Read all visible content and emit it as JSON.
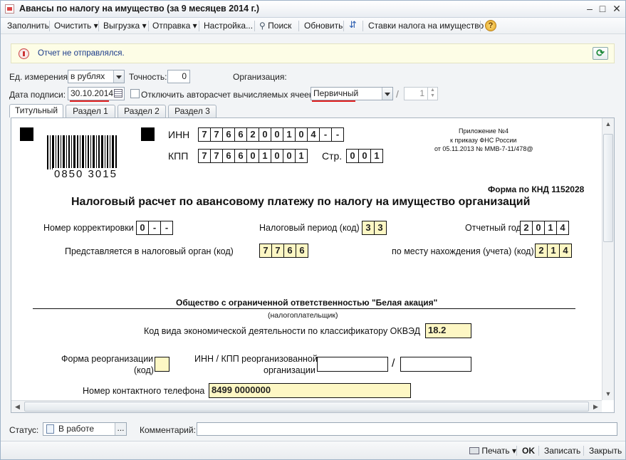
{
  "window": {
    "title": "Авансы по налогу на имущество (за 9 месяцев 2014 г.)"
  },
  "toolbar": {
    "fill": "Заполнить",
    "clear": "Очистить",
    "export": "Выгрузка",
    "send": "Отправка",
    "settings": "Настройка...",
    "search": "Поиск",
    "update": "Обновить",
    "rates": "Ставки налога на имущество",
    "help": "?"
  },
  "notice": {
    "text": "Отчет не отправлялся."
  },
  "params": {
    "unit_label": "Ед. измерения:",
    "unit_value": "в рублях",
    "precision_label": "Точность:",
    "precision_value": "0",
    "org_label": "Организация:",
    "sign_date_label": "Дата подписи:",
    "sign_date_value": "30.10.2014",
    "autocalc_label": "Отключить авторасчет вычисляемых ячеек",
    "report_kind": "Первичный",
    "correction_number": "1"
  },
  "tabs": [
    "Титульный",
    "Раздел 1",
    "Раздел 2",
    "Раздел 3"
  ],
  "form": {
    "inn_label": "ИНН",
    "inn": [
      "7",
      "7",
      "6",
      "6",
      "2",
      "0",
      "0",
      "1",
      "0",
      "4",
      "-",
      "-"
    ],
    "kpp_label": "КПП",
    "kpp": [
      "7",
      "7",
      "6",
      "6",
      "0",
      "1",
      "0",
      "0",
      "1"
    ],
    "page_label": "Стр.",
    "page": [
      "0",
      "0",
      "1"
    ],
    "barcode_digits": "0850 3015",
    "appendix_line1": "Приложение №4",
    "appendix_line2": "к приказу ФНС России",
    "appendix_line3": "от 05.11.2013 № ММВ-7-11/478@",
    "knd": "Форма по КНД 1152028",
    "title": "Налоговый расчет по авансовому платежу по налогу на имущество организаций",
    "correction_label": "Номер корректировки",
    "correction": [
      "0",
      "-",
      "-"
    ],
    "period_label": "Налоговый период  (код)",
    "period": [
      "3",
      "3"
    ],
    "year_label": "Отчетный год",
    "year": [
      "2",
      "0",
      "1",
      "4"
    ],
    "authority_label": "Представляется в налоговый орган  (код)",
    "authority": [
      "7",
      "7",
      "6",
      "6"
    ],
    "location_label": "по месту нахождения (учета)  (код)",
    "location": [
      "2",
      "1",
      "4"
    ],
    "company": "Общество с ограниченной ответственностью \"Белая акация\"",
    "taxpayer_caption": "(налогоплательщик)",
    "okved_label": "Код вида экономической деятельности по классификатору ОКВЭД",
    "okved": "18.2",
    "reorg_label_1": "Форма реорганизации",
    "reorg_label_2": "(код)",
    "reorg_inn_label_1": "ИНН / КПП реорганизованной",
    "reorg_inn_label_2": "организации",
    "slash": "/",
    "phone_label": "Номер контактного телефона",
    "phone": "8499 0000000"
  },
  "status": {
    "label": "Статус:",
    "value": "В работе",
    "dots": "...",
    "comment_label": "Комментарий:"
  },
  "bottom": {
    "print": "Печать",
    "ok": "OK",
    "save": "Записать",
    "close": "Закрыть"
  },
  "icons": [
    "app-icon",
    "minimize-icon",
    "maximize-icon",
    "close-icon",
    "search-icon",
    "arrows-icon",
    "help-icon",
    "notice-icon",
    "refresh-icon",
    "calendar-icon",
    "printer-icon",
    "document-icon"
  ]
}
